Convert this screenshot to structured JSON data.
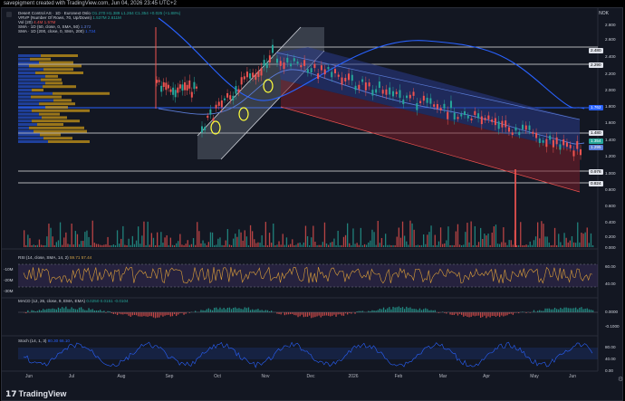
{
  "header": {
    "text": "savepigment created with TradingView.com, Jun 04, 2026 23:45 UTC+2"
  },
  "chart": {
    "currency": "NOK",
    "legend": [
      {
        "text": "Desert Control AS · 1D · Euronext Oslo",
        "values": "O1.270 H1.389 L1.264 C1.354 +0.025 (+1.88%)",
        "color": "#cfd3dc"
      },
      {
        "text": "VRVP (Number Of Rows, 70, Up/Down)",
        "values": "1.537M 2.611M",
        "color": "#cfd3dc"
      },
      {
        "text": "Vol (20)",
        "values": "4.4M 1.57M",
        "color": "#cfd3dc"
      },
      {
        "text": "SMA · 1D (50, close, 0, SMA, 50)",
        "values": "1.372",
        "color": "#5a7bd6"
      },
      {
        "text": "SMA · 1D (200, close, 0, SMA, 200)",
        "values": "1.734",
        "color": "#2962ff"
      }
    ],
    "price_axis": [
      "2.800",
      "2.600",
      "2.400",
      "2.200",
      "2.000",
      "1.800",
      "1.600",
      "1.400",
      "1.200",
      "1.000",
      "0.800",
      "0.600",
      "0.400",
      "0.200",
      "0.000"
    ],
    "price_tags": [
      {
        "label": "2.480",
        "kind": "hline",
        "bg": "#e0e3eb",
        "fg": "#000000"
      },
      {
        "label": "2.290",
        "kind": "hline",
        "bg": "#e0e3eb",
        "fg": "#000000"
      },
      {
        "label": "1.762",
        "kind": "sma",
        "bg": "#2962ff",
        "fg": "#ffffff"
      },
      {
        "label": "1.480",
        "kind": "hline",
        "bg": "#e0e3eb",
        "fg": "#000000"
      },
      {
        "label": "1.354",
        "kind": "last",
        "bg": "#26a69a",
        "fg": "#ffffff"
      },
      {
        "label": "1.295",
        "kind": "sma",
        "bg": "#5a7bd6",
        "fg": "#ffffff"
      },
      {
        "label": "0.976",
        "kind": "hline",
        "bg": "#e0e3eb",
        "fg": "#000000"
      },
      {
        "label": "0.824",
        "kind": "hline",
        "bg": "#e0e3eb",
        "fg": "#000000"
      }
    ],
    "x_axis": [
      "Jun",
      "Jul",
      "Aug",
      "Sep",
      "Oct",
      "Nov",
      "Dec",
      "2026",
      "Feb",
      "Mar",
      "Apr",
      "May",
      "Jun"
    ],
    "colors": {
      "up": "#26a69a",
      "down": "#ef5350",
      "sma50": "#5a7bd6",
      "sma200": "#2962ff",
      "hline": "#ffffff",
      "annotation": "#ffff3b"
    }
  },
  "rsi": {
    "legend": "RSI (14, close, SMA, 14, 2)",
    "values": "59.71 57.44",
    "scale": [
      "60.00",
      "40.00"
    ],
    "left_tags": [
      "-10M",
      "-20M",
      "-30M"
    ]
  },
  "macd": {
    "legend": "MACD (12, 26, close, 9, EMA, EMA)",
    "values": "0.0250 0.0151 -0.0104",
    "scale": [
      "0.0000",
      "-0.1000"
    ]
  },
  "stoch": {
    "legend": "Stoch (14, 1, 3)",
    "values": "80.30 66.10",
    "scale": [
      "80.00",
      "40.00",
      "0.00"
    ]
  },
  "footer": {
    "brand": "TradingView",
    "logo_glyph": "17"
  }
}
